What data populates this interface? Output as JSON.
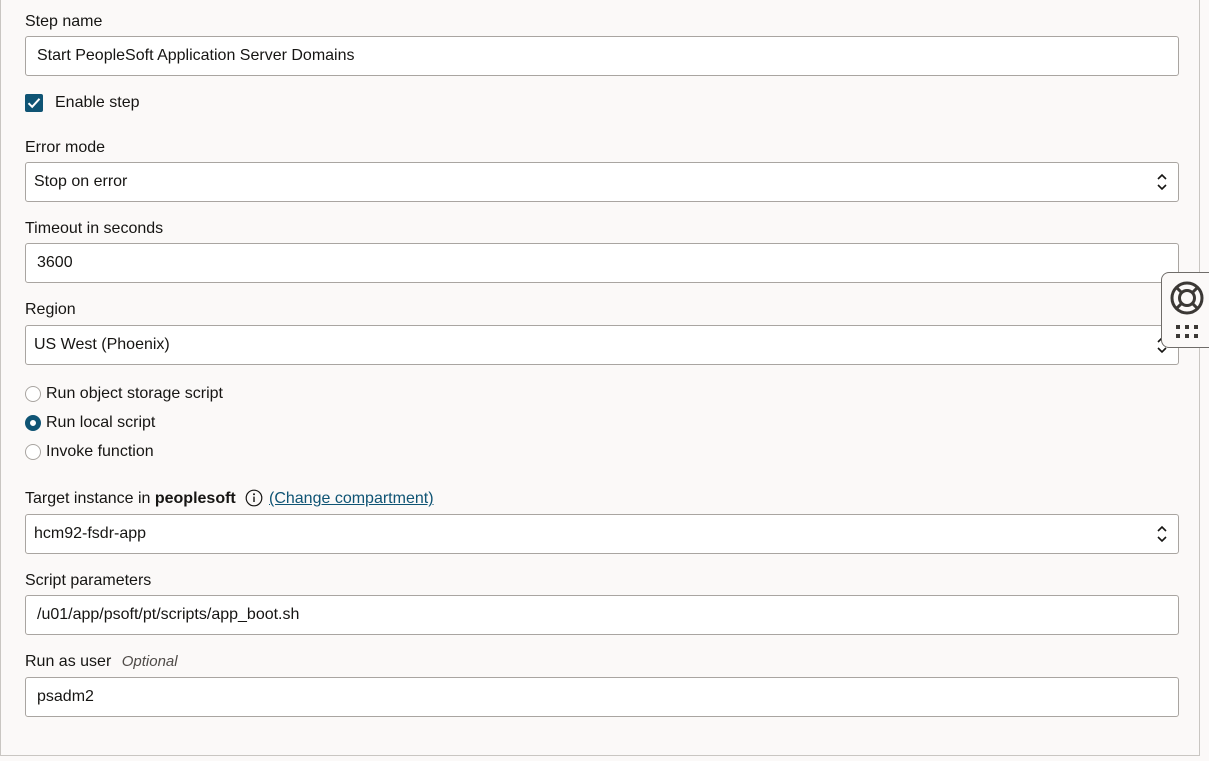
{
  "step_name": {
    "label": "Step name",
    "value": "Start PeopleSoft Application Server Domains"
  },
  "enable_step": {
    "label": "Enable step",
    "checked": true
  },
  "error_mode": {
    "label": "Error mode",
    "value": "Stop on error"
  },
  "timeout": {
    "label": "Timeout in seconds",
    "value": "3600"
  },
  "region": {
    "label": "Region",
    "value": "US West (Phoenix)"
  },
  "script_type": {
    "options": [
      {
        "label": "Run object storage script",
        "selected": false
      },
      {
        "label": "Run local script",
        "selected": true
      },
      {
        "label": "Invoke function",
        "selected": false
      }
    ]
  },
  "target_instance": {
    "label_prefix": "Target instance in",
    "compartment": "peoplesoft",
    "change_link": "(Change compartment)",
    "value": "hcm92-fsdr-app"
  },
  "script_parameters": {
    "label": "Script parameters",
    "value": "/u01/app/psoft/pt/scripts/app_boot.sh"
  },
  "run_as_user": {
    "label": "Run as user",
    "optional": "Optional",
    "value": "psadm2"
  },
  "icons": {
    "checkbox": "checkmark-icon",
    "select": "chevron-up-down-icon",
    "info": "info-icon",
    "help": "lifebuoy-icon",
    "apps": "grid-icon"
  },
  "colors": {
    "accent": "#0f5474",
    "border": "#a9a5a1",
    "background": "#fbf9f8"
  }
}
